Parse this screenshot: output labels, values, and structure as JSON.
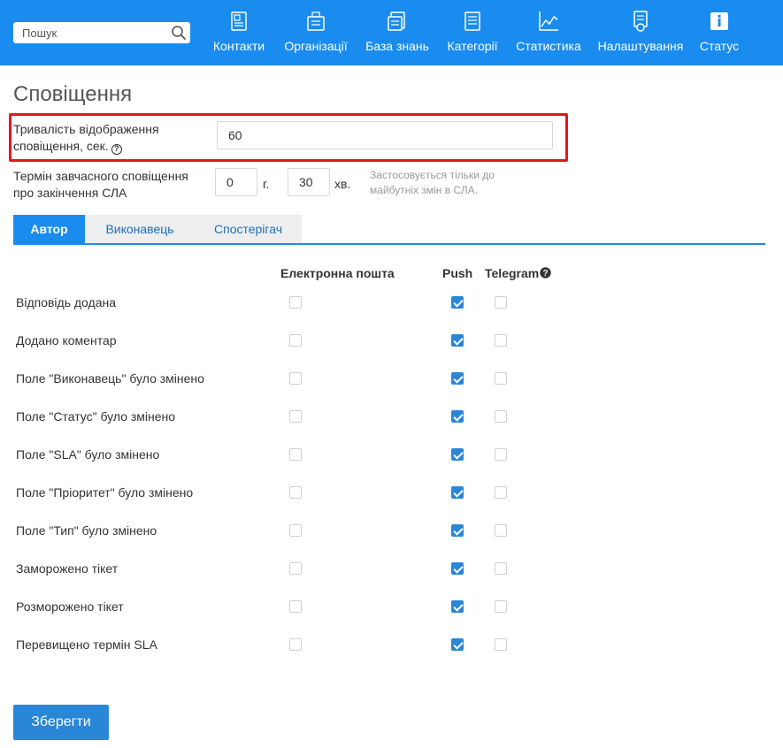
{
  "search": {
    "placeholder": "Пошук"
  },
  "nav": [
    {
      "label": "Контакти",
      "icon": "contacts-icon"
    },
    {
      "label": "Організації",
      "icon": "organizations-icon"
    },
    {
      "label": "База знань",
      "icon": "knowledge-base-icon"
    },
    {
      "label": "Категорії",
      "icon": "categories-icon"
    },
    {
      "label": "Статистика",
      "icon": "statistics-icon"
    },
    {
      "label": "Налаштування",
      "icon": "settings-icon"
    },
    {
      "label": "Статус",
      "icon": "status-info-icon"
    }
  ],
  "page": {
    "title": "Сповіщення"
  },
  "duration": {
    "label_line1": "Тривалість відображення",
    "label_line2": "сповіщення, сек.",
    "value": "60"
  },
  "sla": {
    "label_line1": "Термін завчасного сповіщення",
    "label_line2": "про закінчення СЛА",
    "hours_value": "0",
    "hours_unit": "г.",
    "minutes_value": "30",
    "minutes_unit": "хв.",
    "hint_line1": "Застосовується тільки до",
    "hint_line2": "майбутніх змін в СЛА."
  },
  "tabs": [
    {
      "label": "Автор",
      "active": true
    },
    {
      "label": "Виконавець",
      "active": false
    },
    {
      "label": "Спостерігач",
      "active": false
    }
  ],
  "columns": {
    "email": "Електронна пошта",
    "push": "Push",
    "telegram": "Telegram"
  },
  "rows": [
    {
      "label": "Відповідь додана",
      "email": false,
      "push": true,
      "telegram": false
    },
    {
      "label": "Додано коментар",
      "email": false,
      "push": true,
      "telegram": false
    },
    {
      "label": "Поле \"Виконавець\" було змінено",
      "email": false,
      "push": true,
      "telegram": false
    },
    {
      "label": "Поле \"Статус\" було змінено",
      "email": false,
      "push": true,
      "telegram": false
    },
    {
      "label": "Поле \"SLA\" було змінено",
      "email": false,
      "push": true,
      "telegram": false
    },
    {
      "label": "Поле \"Пріоритет\" було змінено",
      "email": false,
      "push": true,
      "telegram": false
    },
    {
      "label": "Поле \"Тип\" було змінено",
      "email": false,
      "push": true,
      "telegram": false
    },
    {
      "label": "Заморожено тікет",
      "email": false,
      "push": true,
      "telegram": false
    },
    {
      "label": "Розморожено тікет",
      "email": false,
      "push": true,
      "telegram": false
    },
    {
      "label": "Перевищено термін SLA",
      "email": false,
      "push": true,
      "telegram": false
    }
  ],
  "save_label": "Зберегти",
  "colors": {
    "primary": "#1a8cf0",
    "button": "#2a86d6",
    "highlight": "#e8141c"
  }
}
